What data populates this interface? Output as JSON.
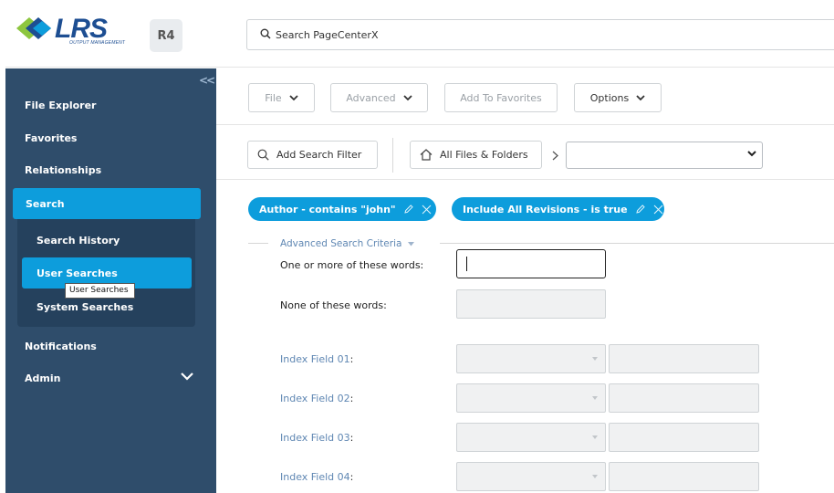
{
  "header": {
    "logo_text": "LRS",
    "logo_subtitle": "OUTPUT MANAGEMENT",
    "badge": "R4",
    "search_placeholder": "Search PageCenterX"
  },
  "sidebar": {
    "collapse_label": "<<",
    "items": [
      {
        "label": "File Explorer"
      },
      {
        "label": "Favorites"
      },
      {
        "label": "Relationships"
      },
      {
        "label": "Search"
      },
      {
        "label": "Notifications"
      },
      {
        "label": "Admin"
      }
    ],
    "search_sub": [
      {
        "label": "Search History"
      },
      {
        "label": "User Searches"
      },
      {
        "label": "System Searches"
      }
    ],
    "tooltip": "User Searches"
  },
  "toolbar": {
    "file": "File",
    "advanced": "Advanced",
    "add_favorites": "Add To Favorites",
    "options": "Options"
  },
  "filters": {
    "add_filter": "Add Search Filter",
    "all_files": "All Files & Folders",
    "select_value": ""
  },
  "chips": [
    {
      "label": "Author - contains \"john\""
    },
    {
      "label": "Include All Revisions - is true"
    }
  ],
  "advanced": {
    "title": "Advanced Search Criteria",
    "one_or_more_label": "One or more of these words:",
    "one_or_more_value": "",
    "none_label": "None of these words:",
    "none_value": "",
    "index_fields": [
      {
        "label": "Index Field 01",
        "colon": ":"
      },
      {
        "label": "Index Field 02",
        "colon": ":"
      },
      {
        "label": "Index Field 03",
        "colon": ":"
      },
      {
        "label": "Index Field 04",
        "colon": ":"
      }
    ]
  },
  "colors": {
    "sidebar_bg": "#2f4d6b",
    "accent": "#0d9ddc",
    "brand": "#1d4e92"
  }
}
